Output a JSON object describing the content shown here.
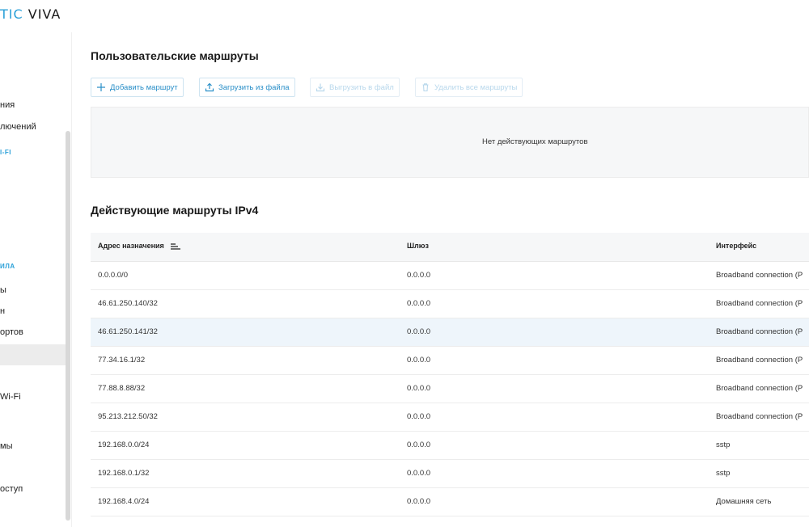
{
  "logo": {
    "part1": "TIC",
    "part2": " VIVA"
  },
  "sidebar": {
    "items": [
      {
        "label": "ния"
      },
      {
        "label": "лючений"
      },
      {
        "label": "ы"
      },
      {
        "label": "н"
      },
      {
        "label": "ортов"
      },
      {
        "label": "Wi-Fi"
      },
      {
        "label": "мы"
      },
      {
        "label": "оступ"
      }
    ],
    "sections": [
      {
        "label": "I-FI"
      },
      {
        "label": "ИЛА"
      }
    ]
  },
  "custom_routes": {
    "title": "Пользовательские маршруты",
    "buttons": {
      "add": "Добавить маршрут",
      "upload": "Загрузить из файла",
      "export": "Выгрузить в файл",
      "delete_all": "Удалить все маршруты"
    },
    "empty_text": "Нет действующих маршрутов"
  },
  "active_routes": {
    "title": "Действующие маршруты IPv4",
    "columns": [
      "Адрес назначения",
      "Шлюз",
      "Интерфейс"
    ],
    "rows": [
      {
        "dest": "0.0.0.0/0",
        "gateway": "0.0.0.0",
        "iface": "Broadband connection (P"
      },
      {
        "dest": "46.61.250.140/32",
        "gateway": "0.0.0.0",
        "iface": "Broadband connection (P"
      },
      {
        "dest": "46.61.250.141/32",
        "gateway": "0.0.0.0",
        "iface": "Broadband connection (P"
      },
      {
        "dest": "77.34.16.1/32",
        "gateway": "0.0.0.0",
        "iface": "Broadband connection (P"
      },
      {
        "dest": "77.88.8.88/32",
        "gateway": "0.0.0.0",
        "iface": "Broadband connection (P"
      },
      {
        "dest": "95.213.212.50/32",
        "gateway": "0.0.0.0",
        "iface": "Broadband connection (P"
      },
      {
        "dest": "192.168.0.0/24",
        "gateway": "0.0.0.0",
        "iface": "sstp"
      },
      {
        "dest": "192.168.0.1/32",
        "gateway": "0.0.0.0",
        "iface": "sstp"
      },
      {
        "dest": "192.168.4.0/24",
        "gateway": "0.0.0.0",
        "iface": "Домашняя сеть"
      }
    ]
  },
  "colors": {
    "accent": "#2aa0d8",
    "highlight_row": "#eef5fb"
  },
  "icons": {
    "add": "plus-icon",
    "upload": "upload-icon",
    "export": "download-icon",
    "delete_all": "trash-icon",
    "sort": "sort-icon"
  }
}
